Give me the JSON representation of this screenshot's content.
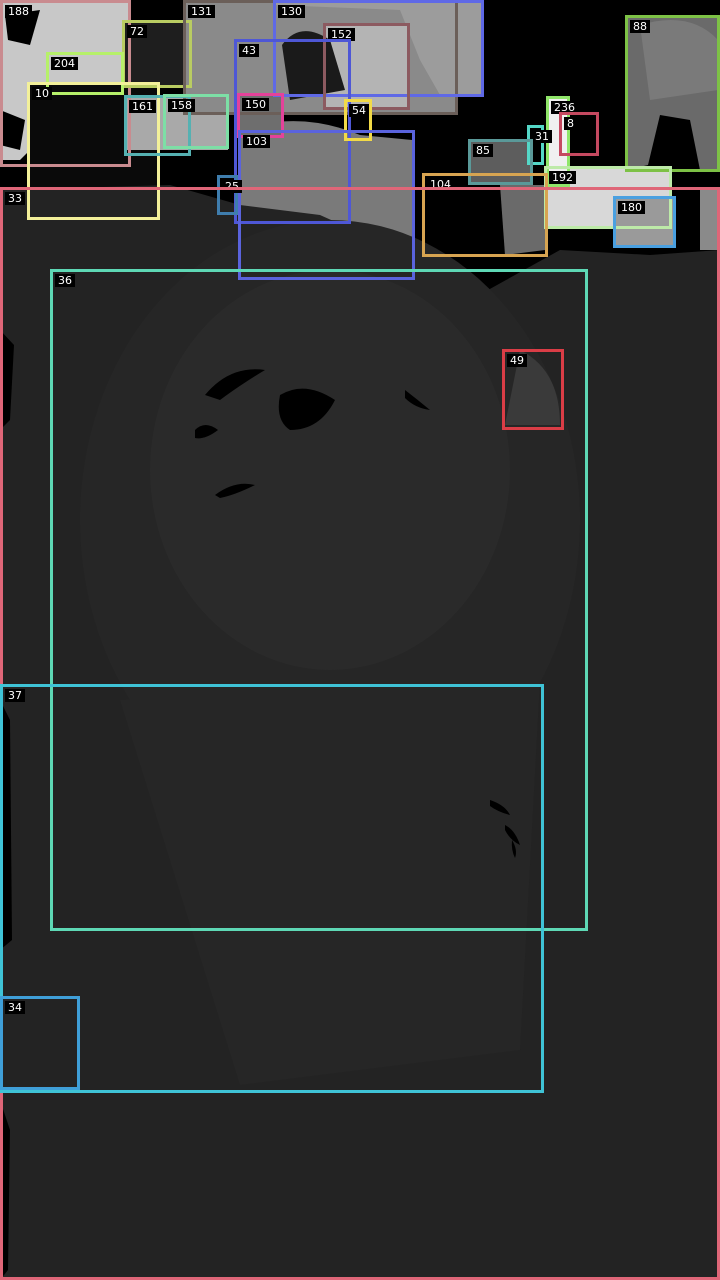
{
  "regions": [
    {
      "label": "188",
      "color": "#c98b8f"
    },
    {
      "label": "72",
      "color": "#b9cc62"
    },
    {
      "label": "204",
      "color": "#b6f06a"
    },
    {
      "label": "10",
      "color": "#f3f09a"
    },
    {
      "label": "131",
      "color": "#6b5f59"
    },
    {
      "label": "130",
      "color": "#5f69e6"
    },
    {
      "label": "152",
      "color": "#8c5a60"
    },
    {
      "label": "43",
      "color": "#4e57d6"
    },
    {
      "label": "161",
      "color": "#55b1b2"
    },
    {
      "label": "158",
      "color": "#7ddfa6"
    },
    {
      "label": "150",
      "color": "#e4429a"
    },
    {
      "label": "54",
      "color": "#f2da47"
    },
    {
      "label": "103",
      "color": "#5a63dd"
    },
    {
      "label": "25",
      "color": "#3f7dad"
    },
    {
      "label": "88",
      "color": "#7dc146"
    },
    {
      "label": "236",
      "color": "#90e66a"
    },
    {
      "label": "31",
      "color": "#54d7c7"
    },
    {
      "label": "85",
      "color": "#5a9999"
    },
    {
      "label": "8",
      "color": "#c54960"
    },
    {
      "label": "192",
      "color": "#bdeaa8"
    },
    {
      "label": "180",
      "color": "#4aa0e0"
    },
    {
      "label": "104",
      "color": "#d7a451"
    },
    {
      "label": "33",
      "color": "#df6678"
    },
    {
      "label": "36",
      "color": "#5ed8b5"
    },
    {
      "label": "49",
      "color": "#da3d46"
    },
    {
      "label": "37",
      "color": "#3fc3d6"
    },
    {
      "label": "34",
      "color": "#3f9fd8"
    }
  ]
}
